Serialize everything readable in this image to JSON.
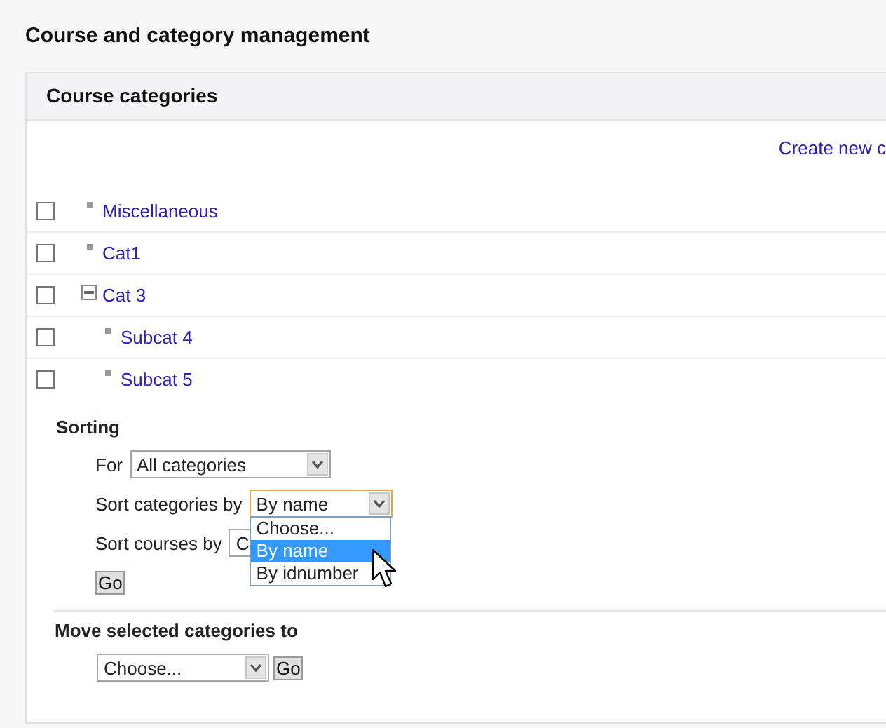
{
  "page_title": "Course and category management",
  "panel": {
    "title": "Course categories",
    "create_link": "Create new c"
  },
  "categories": [
    {
      "name": "Miscellaneous",
      "checked": false,
      "expanded": false
    },
    {
      "name": "Cat1",
      "checked": false,
      "expanded": false
    },
    {
      "name": "Cat 3",
      "checked": false,
      "expanded": true,
      "children": [
        {
          "name": "Subcat 4",
          "checked": false,
          "expanded": false
        },
        {
          "name": "Subcat 5",
          "checked": false,
          "expanded": false
        }
      ]
    }
  ],
  "sorting": {
    "heading": "Sorting",
    "for_label": "For",
    "for_value": "All categories",
    "categories_label": "Sort categories by",
    "categories_value": "By name",
    "categories_options": [
      {
        "label": "Choose...",
        "selected": false
      },
      {
        "label": "By name",
        "selected": true
      },
      {
        "label": "By idnumber",
        "selected": false
      }
    ],
    "courses_label": "Sort courses by",
    "courses_value": "C",
    "go": "Go"
  },
  "move": {
    "heading": "Move selected categories to",
    "value": "Choose...",
    "go": "Go"
  }
}
